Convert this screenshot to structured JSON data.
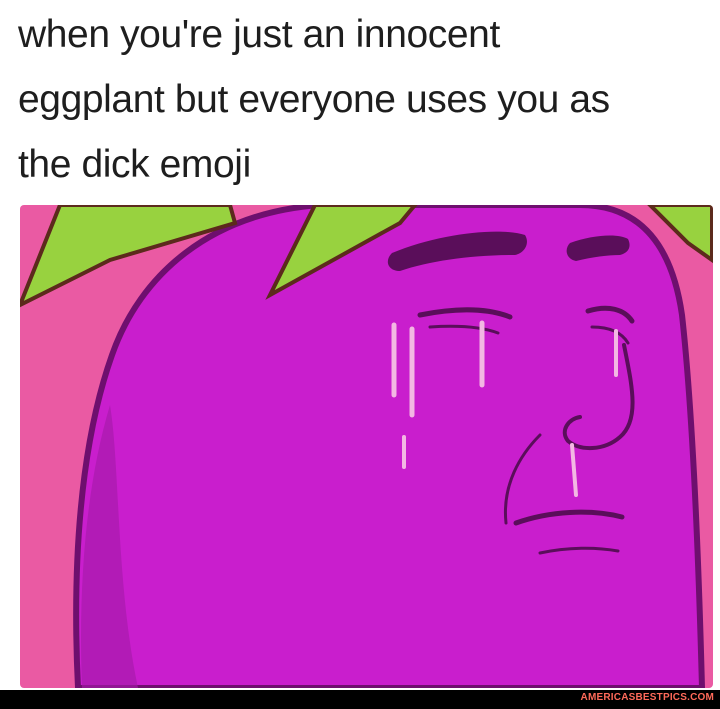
{
  "caption": {
    "line1": "when you're just an innocent",
    "line2": "eggplant but everyone uses you as",
    "line3": "the dick emoji"
  },
  "illustration": {
    "subject": "eggplant-face-icon",
    "colors": {
      "background": "#ea5aa3",
      "eggplant": "#c91ecd",
      "leaves": "#98d23f",
      "outline": "#6e0f6e",
      "tears": "#f3b7e3"
    }
  },
  "footer": {
    "watermark": "AMERICASBESTPICS.COM"
  }
}
